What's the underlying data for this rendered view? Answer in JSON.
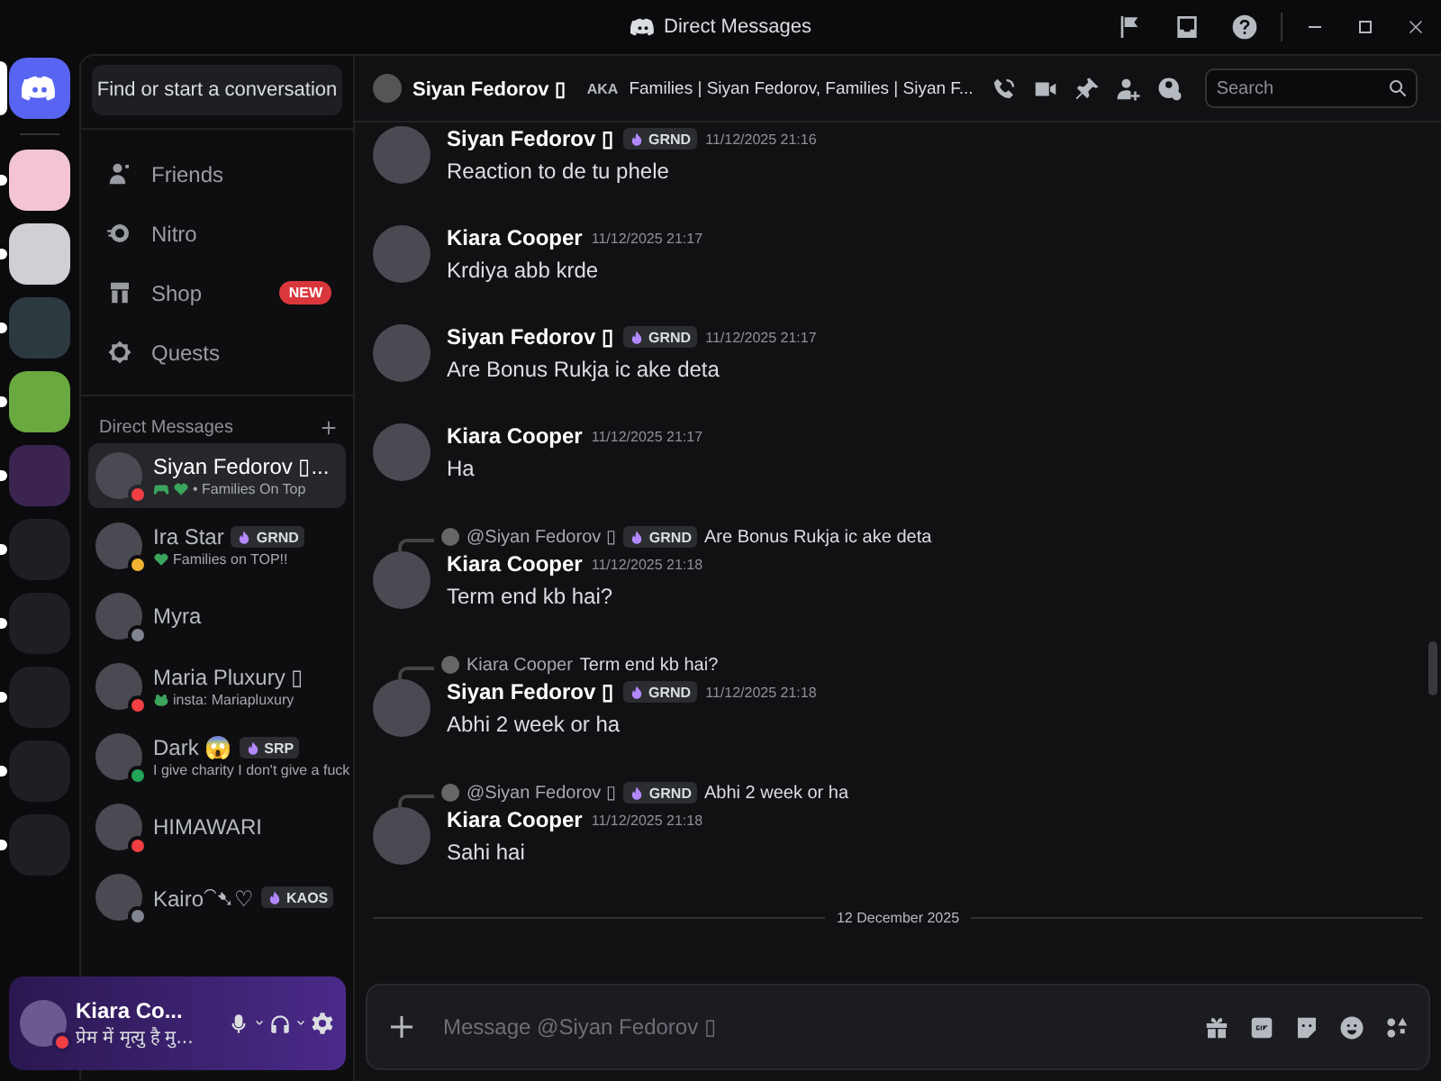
{
  "window": {
    "title": "Direct Messages"
  },
  "servers": [
    {
      "kind": "home",
      "selected": true,
      "unread": false
    },
    {
      "kind": "server",
      "selected": false,
      "unread": true
    },
    {
      "kind": "server",
      "selected": false,
      "unread": true
    },
    {
      "kind": "server",
      "selected": false,
      "unread": true
    },
    {
      "kind": "server",
      "selected": false,
      "unread": true
    },
    {
      "kind": "server",
      "selected": false,
      "unread": true
    },
    {
      "kind": "folder",
      "selected": false,
      "unread": true
    },
    {
      "kind": "folder",
      "selected": false,
      "unread": true
    },
    {
      "kind": "folder",
      "selected": false,
      "unread": true
    },
    {
      "kind": "folder",
      "selected": false,
      "unread": true
    },
    {
      "kind": "folder",
      "selected": false,
      "unread": true
    }
  ],
  "sidebar": {
    "search_button": "Find or start a conversation",
    "nav": [
      {
        "kind": "friends",
        "label": "Friends"
      },
      {
        "kind": "nitro",
        "label": "Nitro"
      },
      {
        "kind": "shop",
        "label": "Shop",
        "badge": "NEW"
      },
      {
        "kind": "quests",
        "label": "Quests"
      }
    ],
    "dm_header": "Direct Messages",
    "dms": [
      {
        "kind": "game",
        "name": "Siyan Fedorov ▯...",
        "color": "#f23f43",
        "selected": true,
        "activity": "• Families On Top"
      },
      {
        "kind": "heart",
        "name": "Ira Star",
        "tag": "GRND",
        "color": "#f0b232",
        "selected": false,
        "activity": "Families on TOP!!"
      },
      {
        "kind": "plain",
        "name": "Myra",
        "color": "#80848e",
        "selected": false
      },
      {
        "kind": "emoji",
        "name": "Maria Pluxury ▯",
        "color": "#f23f43",
        "selected": false,
        "activity": "insta: Mariapluxury"
      },
      {
        "kind": "plain",
        "name": "Dark 😱",
        "tag": "SRP",
        "color": "#23a55a",
        "selected": false,
        "activity": "I give charity I don't give a fuck"
      },
      {
        "kind": "plain",
        "name": "HIMAWARI",
        "color": "#f23f43",
        "selected": false
      },
      {
        "kind": "plain",
        "name": "Kairo⁀➷♡",
        "tag": "KAOS",
        "color": "#80848e",
        "selected": false
      }
    ]
  },
  "user_panel": {
    "name": "Kiara Co...",
    "status_text": "प्रेम में मृत्यु है मु...",
    "color": "#f23f43"
  },
  "chat": {
    "recipient": "Siyan Fedorov ▯",
    "aka_label": "AKA",
    "aka": "Families | Siyan Fedorov, Families | Siyan F...",
    "search": {
      "placeholder": "Search"
    },
    "messages": [
      {
        "author": "Siyan Fedorov ▯",
        "tag": "GRND",
        "time": "11/12/2025 21:16",
        "text": "Reaction to de tu phele"
      },
      {
        "author": "Kiara Cooper",
        "time": "11/12/2025 21:17",
        "text": "Krdiya abb krde"
      },
      {
        "author": "Siyan Fedorov ▯",
        "tag": "GRND",
        "time": "11/12/2025 21:17",
        "text": "Are Bonus Rukja ic ake deta"
      },
      {
        "author": "Kiara Cooper",
        "time": "11/12/2025 21:17",
        "text": "Ha"
      },
      {
        "reply": {
          "author": "@Siyan Fedorov ▯",
          "tag": "GRND",
          "text": "Are Bonus Rukja ic ake deta"
        },
        "author": "Kiara Cooper",
        "time": "11/12/2025 21:18",
        "text": "Term end kb hai?"
      },
      {
        "reply": {
          "author": "Kiara Cooper",
          "text": "Term end kb hai?"
        },
        "author": "Siyan Fedorov ▯",
        "tag": "GRND",
        "time": "11/12/2025 21:18",
        "text": "Abhi 2 week or ha"
      },
      {
        "reply": {
          "author": "@Siyan Fedorov ▯",
          "tag": "GRND",
          "text": "Abhi 2 week or ha"
        },
        "author": "Kiara Cooper",
        "time": "11/12/2025 21:18",
        "text": "Sahi hai"
      }
    ],
    "date_divider": "12 December 2025",
    "composer": {
      "placeholder": "Message @Siyan Fedorov ▯"
    }
  }
}
